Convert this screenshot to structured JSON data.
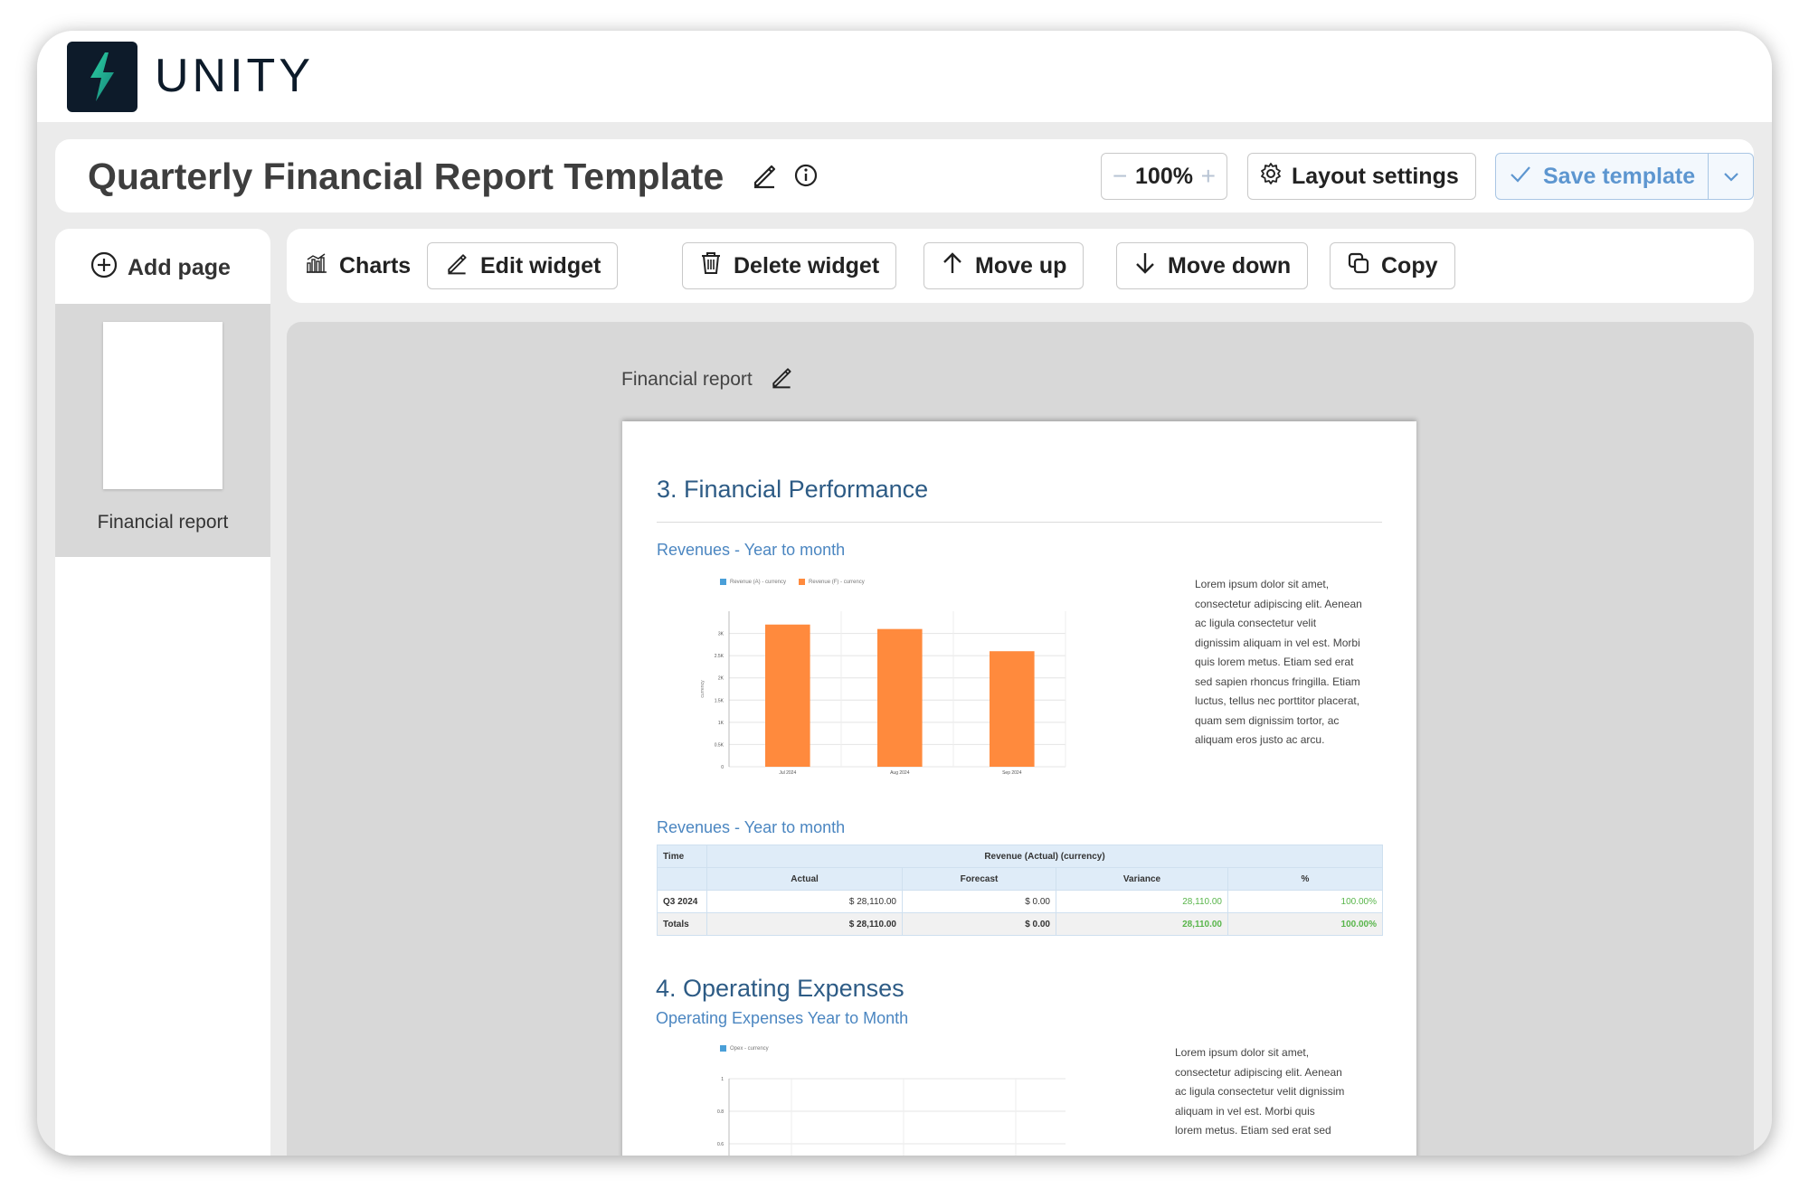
{
  "app": {
    "brand": "UNITY"
  },
  "header": {
    "title": "Quarterly Financial Report Template",
    "zoom": "100%",
    "zoom_minus": "−",
    "zoom_plus": "+",
    "layout_settings_label": "Layout settings",
    "save_template_label": "Save template"
  },
  "sidebar": {
    "add_page_label": "Add page",
    "pages": [
      {
        "label": "Financial report"
      }
    ]
  },
  "toolbar": {
    "charts_label": "Charts",
    "edit_widget_label": "Edit widget",
    "delete_widget_label": "Delete widget",
    "move_up_label": "Move up",
    "move_down_label": "Move down",
    "copy_label": "Copy"
  },
  "canvas": {
    "page_title": "Financial report",
    "sections": [
      {
        "heading": "3. Financial Performance"
      },
      {
        "heading": "4. Operating Expenses"
      }
    ],
    "chart1_title": "Revenues - Year to month",
    "table_title": "Revenues - Year to month",
    "chart2_title": "Operating Expenses Year to Month",
    "lorem1": [
      "Lorem ipsum dolor sit amet,",
      "consectetur adipiscing elit. Aenean",
      "ac ligula consectetur velit",
      "dignissim aliquam in vel est. Morbi",
      "quis lorem metus. Etiam sed erat",
      "sed sapien rhoncus fringilla. Etiam",
      "luctus, tellus nec porttitor placerat,",
      "quam sem dignissim tortor, ac",
      "aliquam eros justo ac arcu."
    ],
    "lorem2": [
      "Lorem ipsum dolor sit amet,",
      "consectetur adipiscing elit. Aenean",
      "ac ligula consectetur velit dignissim",
      "aliquam in vel est. Morbi quis",
      "lorem metus. Etiam sed erat sed"
    ],
    "table": {
      "group_headers": [
        "Time",
        "Revenue (Actual) (currency)"
      ],
      "sub_headers": [
        "Actual",
        "Forecast",
        "Variance",
        "%"
      ],
      "rows": [
        {
          "time": "Q3 2024",
          "actual": "$ 28,110.00",
          "forecast": "$ 0.00",
          "variance": "28,110.00",
          "pct": "100.00%"
        }
      ],
      "totals": {
        "time": "Totals",
        "actual": "$ 28,110.00",
        "forecast": "$ 0.00",
        "variance": "28,110.00",
        "pct": "100.00%"
      }
    }
  },
  "chart_data": [
    {
      "type": "bar",
      "title": "Revenues - Year to month",
      "categories": [
        "Jul 2024",
        "Aug 2024",
        "Sep 2024"
      ],
      "series": [
        {
          "name": "Revenue (A) - currency",
          "color": "#4a9fd8",
          "values": [
            0,
            0,
            0
          ]
        },
        {
          "name": "Revenue (F) - currency",
          "color": "#ff8a3d",
          "values": [
            32,
            31,
            26
          ]
        }
      ],
      "yticks": [
        "0",
        "0.5K",
        "1K",
        "1.5K",
        "2K",
        "2.5K",
        "3K"
      ],
      "ylim": [
        0,
        35
      ],
      "ylabel": "currency",
      "grid": true,
      "legend": "top-left"
    },
    {
      "type": "bar",
      "title": "Operating Expenses Year to Month",
      "categories": [],
      "series": [
        {
          "name": "Opex - currency",
          "color": "#4a9fd8",
          "values": []
        }
      ],
      "yticks": [
        "1",
        "0.8",
        "0.6"
      ],
      "grid": true,
      "legend": "top-left"
    }
  ]
}
